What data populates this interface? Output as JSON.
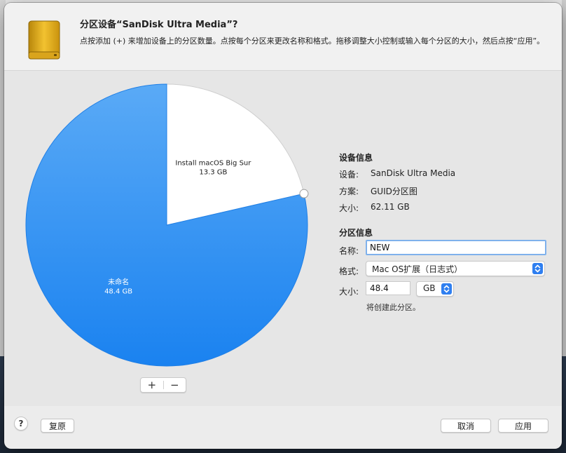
{
  "dialog": {
    "title": "分区设备“SanDisk Ultra Media”?",
    "subtitle": "点按添加 (+) 来增加设备上的分区数量。点按每个分区来更改名称和格式。拖移调整大小控制或输入每个分区的大小，然后点按“应用”。",
    "icon": "external-drive-icon"
  },
  "pie": {
    "partitions": [
      {
        "name": "Install macOS Big Sur",
        "size": "13.3 GB",
        "fraction": 0.2142,
        "color": "#ffffff",
        "text_color": "#1a1a1a"
      },
      {
        "name": "未命名",
        "size": "48.4 GB",
        "fraction": 0.7858,
        "color": "#2a8ef2",
        "text_color": "#ffffff"
      }
    ],
    "add_label": "+",
    "remove_label": "−"
  },
  "device_info": {
    "title": "设备信息",
    "device_label": "设备:",
    "device_value": "SanDisk Ultra Media",
    "scheme_label": "方案:",
    "scheme_value": "GUID分区图",
    "size_label": "大小:",
    "size_value": "62.11 GB"
  },
  "partition_info": {
    "title": "分区信息",
    "name_label": "名称:",
    "name_value": "NEW",
    "format_label": "格式:",
    "format_value": "Mac OS扩展（日志式）",
    "size_label": "大小:",
    "size_value": "48.4",
    "unit_value": "GB",
    "note": "将创建此分区。"
  },
  "footer": {
    "help_label": "?",
    "revert_label": "复原",
    "cancel_label": "取消",
    "apply_label": "应用"
  },
  "colors": {
    "accent": "#2f7ff0",
    "partition_blue": "#2a8ef2"
  }
}
